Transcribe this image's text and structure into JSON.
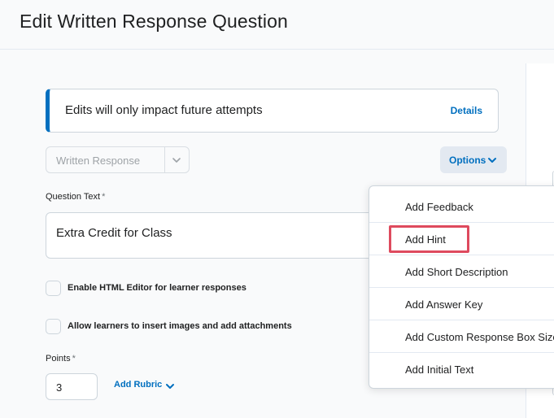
{
  "header": {
    "title": "Edit Written Response Question"
  },
  "alert": {
    "message": "Edits will only impact future attempts",
    "link": "Details"
  },
  "question_type": {
    "selected": "Written Response"
  },
  "options_button": {
    "label": "Options"
  },
  "question_text": {
    "label": "Question Text",
    "required_mark": "*",
    "value": "Extra Credit for Class"
  },
  "checkboxes": [
    {
      "label": "Enable HTML Editor for learner responses",
      "checked": false
    },
    {
      "label": "Allow learners to insert images and add attachments",
      "checked": false
    }
  ],
  "points": {
    "label": "Points",
    "required_mark": "*",
    "value": "3"
  },
  "add_rubric": {
    "label": "Add Rubric"
  },
  "options_menu": {
    "items": [
      {
        "label": "Add Feedback"
      },
      {
        "label": "Add Hint"
      },
      {
        "label": "Add Short Description"
      },
      {
        "label": "Add Answer Key"
      },
      {
        "label": "Add Custom Response Box Size"
      },
      {
        "label": "Add Initial Text"
      }
    ],
    "highlighted_item": "Add Hint"
  },
  "colors": {
    "accent": "#006fbf",
    "highlight": "#de4a5e",
    "border": "#cdd5dc"
  }
}
